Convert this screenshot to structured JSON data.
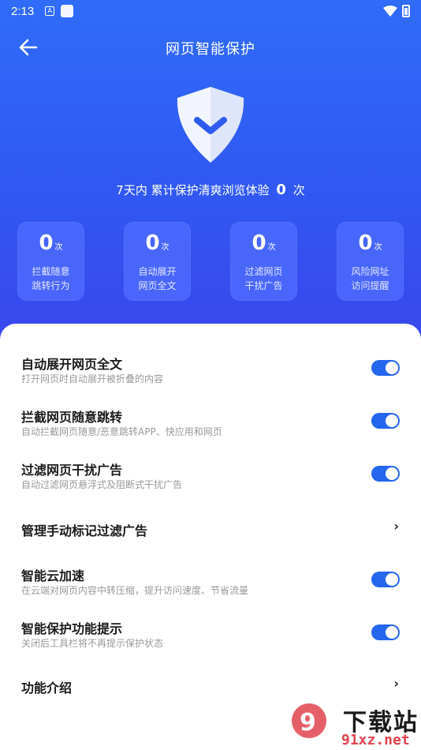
{
  "status_bar": {
    "time": "2:13"
  },
  "header": {
    "title": "网页智能保护"
  },
  "summary": {
    "prefix": "7天内 累计保护清爽浏览体验",
    "count": "0",
    "suffix": "次"
  },
  "stats": [
    {
      "value": "0",
      "unit": "次",
      "line1": "拦截随意",
      "line2": "跳转行为"
    },
    {
      "value": "0",
      "unit": "次",
      "line1": "自动展开",
      "line2": "网页全文"
    },
    {
      "value": "0",
      "unit": "次",
      "line1": "过滤网页",
      "line2": "干扰广告"
    },
    {
      "value": "0",
      "unit": "次",
      "line1": "风险网址",
      "line2": "访问提醒"
    }
  ],
  "settings": [
    {
      "title": "自动展开网页全文",
      "subtitle": "打开网页时自动展开被折叠的内容",
      "control": "toggle",
      "on": true
    },
    {
      "title": "拦截网页随意跳转",
      "subtitle": "自动拦截网页随意/恶意跳转APP、快应用和网页",
      "control": "toggle",
      "on": true
    },
    {
      "title": "过滤网页干扰广告",
      "subtitle": "自动过滤网页悬浮式及阻断式干扰广告",
      "control": "toggle",
      "on": true
    },
    {
      "title": "管理手动标记过滤广告",
      "subtitle": "",
      "control": "chevron",
      "chevron": "›"
    },
    {
      "title": "智能云加速",
      "subtitle": "在云端对网页内容中转压缩，提升访问速度、节省流量",
      "control": "toggle",
      "on": true
    },
    {
      "title": "智能保护功能提示",
      "subtitle": "关闭后工具栏将不再提示保护状态",
      "control": "toggle",
      "on": true
    },
    {
      "title": "功能介绍",
      "subtitle": "",
      "control": "chevron",
      "chevron": "›"
    }
  ],
  "watermark": {
    "text": "下载站",
    "url": "91xz.net"
  },
  "colors": {
    "accent": "#2566ee",
    "hero_top": "#2f6cf8",
    "hero_bottom": "#3a46ec"
  }
}
